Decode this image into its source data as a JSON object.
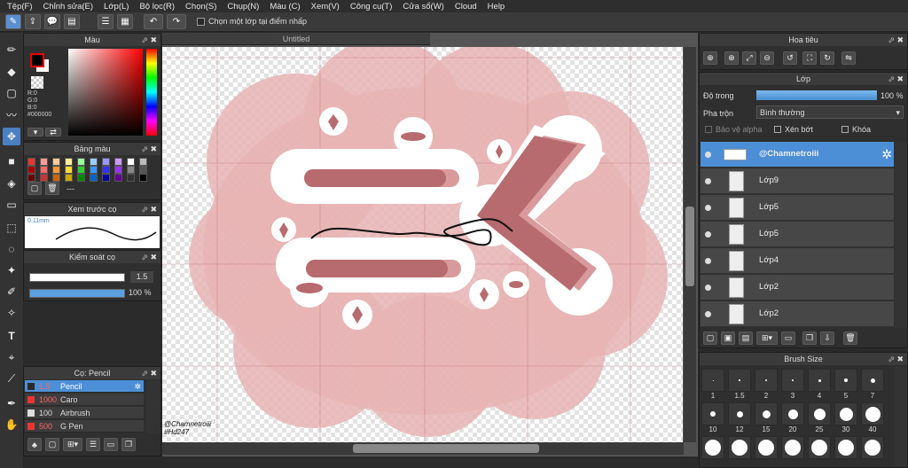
{
  "menu": [
    "Tệp(F)",
    "Chỉnh sửa(E)",
    "Lớp(L)",
    "Bộ lọc(R)",
    "Chọn(S)",
    "Chụp(N)",
    "Màu (C)",
    "Xem(V)",
    "Công cụ(T)",
    "Cửa sổ(W)",
    "Cloud",
    "Help"
  ],
  "toolbar": {
    "select_checkbox_label": "Chọn một lớp tại điểm nhấp"
  },
  "color_panel": {
    "title": "Màu",
    "r": "R:0",
    "g": "G:0",
    "b": "B:0",
    "hex": "#000000"
  },
  "palette_panel": {
    "title": "Bảng màu",
    "dashes": "---"
  },
  "preview_panel": {
    "title": "Xem trước cọ",
    "size": "0.11mm"
  },
  "control_panel": {
    "title": "Kiểm soát cọ",
    "size_value": "1.5",
    "opacity_value": "100 %"
  },
  "brush_panel": {
    "title": "Cọ: Pencil",
    "items": [
      {
        "size": "1.5",
        "name": "Pencil",
        "color": "#2a2a2a"
      },
      {
        "size": "1000",
        "name": "Caro",
        "color": "#e33"
      },
      {
        "size": "100",
        "name": "Airbrush",
        "color": "#ddd"
      },
      {
        "size": "500",
        "name": "G Pen",
        "color": "#e33"
      }
    ]
  },
  "canvas": {
    "tab_title": "Untitled",
    "watermark_line1": "@Chamnetroiii",
    "watermark_line2": "#Hd247"
  },
  "navigator": {
    "title": "Hoa tiêu"
  },
  "layer_panel": {
    "title": "Lớp",
    "opacity_label": "Độ trong",
    "opacity_value": "100 %",
    "blend_label": "Pha trộn",
    "blend_value": "Bình thường",
    "protect_alpha": "Bảo vệ alpha",
    "clipping": "Xén bớt",
    "lock": "Khóa",
    "layers": [
      "@Chamnetroiii",
      "Lớp9",
      "Lớp5",
      "Lớp5",
      "Lớp4",
      "Lớp2",
      "Lớp2"
    ]
  },
  "brush_size": {
    "title": "Brush Size",
    "row1": [
      "1",
      "1.5",
      "2",
      "3",
      "4",
      "5",
      "7"
    ],
    "row2": [
      "10",
      "12",
      "15",
      "20",
      "25",
      "30",
      "40"
    ]
  }
}
